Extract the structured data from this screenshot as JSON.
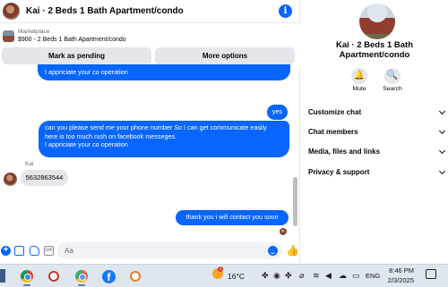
{
  "chat": {
    "title": "Kai · 2 Beds 1 Bath Apartment/condo",
    "info_icon_glyph": "i",
    "marketplace": {
      "label": "Marketplace",
      "item": "$900 - 2 Beds 1 Bath Apartment/condo",
      "mark_pending_label": "Mark as pending",
      "more_options_label": "More options"
    },
    "messages": {
      "top_partial": "I appriciate your co operation",
      "yes": "yes",
      "long_lines": [
        "can you please send me your phone number So I can get communicate easily",
        "here is too much rush on facebook messeges.",
        "I appriciate your co operation"
      ],
      "sender_name": "Kai",
      "incoming_phone": "5632863544",
      "thanks": "thank you i will contact you soon"
    },
    "composer": {
      "placeholder": "Aa",
      "gif_label": "GIF",
      "like_glyph": "👍"
    }
  },
  "details": {
    "title": "Kai · 2 Beds 1 Bath Apartment/condo",
    "actions": [
      {
        "label": "Mute",
        "icon": "bell-icon",
        "glyph": "🔔"
      },
      {
        "label": "Search",
        "icon": "search-icon",
        "glyph": "🔍"
      }
    ],
    "sections": [
      "Customize chat",
      "Chat members",
      "Media, files and links",
      "Privacy & support"
    ]
  },
  "taskbar": {
    "weather_badge": "1",
    "temperature": "16°C",
    "language": "ENG",
    "time": "8:46 PM",
    "date": "2/3/2025",
    "apps": [
      "chrome-icon",
      "paint-app-icon",
      "chrome-profile-icon",
      "facebook-icon",
      "pinwheel-app-icon"
    ]
  },
  "colors": {
    "messenger_blue": "#0866ff",
    "bubble_gray": "#e4e6eb",
    "taskbar_bg": "#dfe6ee"
  }
}
